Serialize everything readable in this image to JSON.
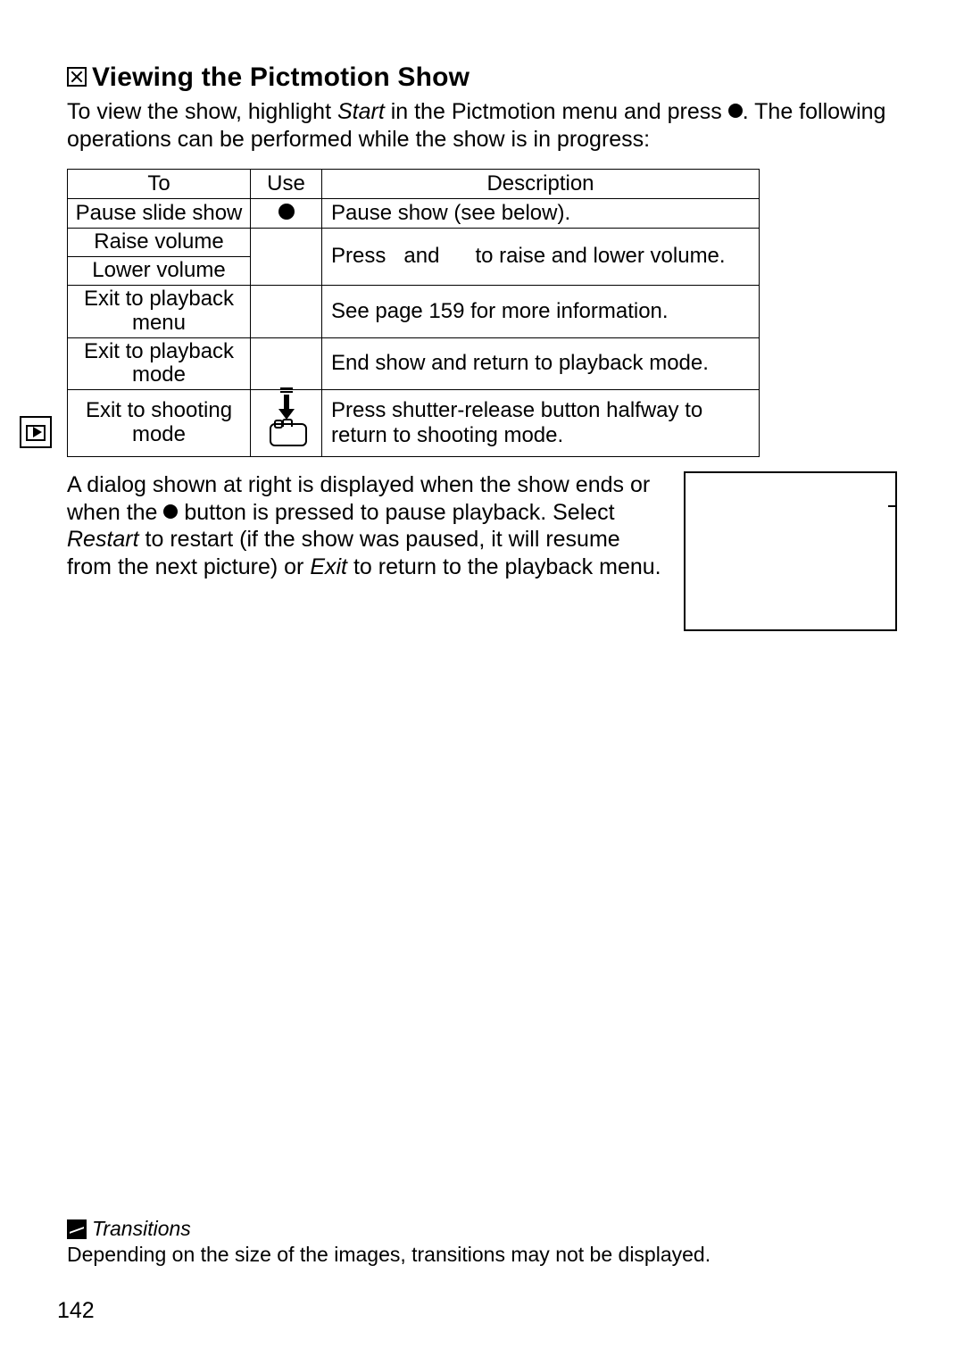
{
  "section": {
    "title": "Viewing the Pictmotion Show"
  },
  "intro": {
    "pre": "To view the show, highlight ",
    "start_word": "Start",
    "mid": " in the Pictmotion menu and press ",
    "post": ".  The following operations can be performed while the show is in progress:"
  },
  "table": {
    "headers": {
      "to": "To",
      "use": "Use",
      "desc": "Description"
    },
    "rows": {
      "pause": {
        "to": "Pause slide show",
        "desc": "Pause show (see below)."
      },
      "raise": {
        "to": "Raise volume"
      },
      "lower": {
        "to": "Lower volume"
      },
      "vol_desc": {
        "press": "Press",
        "and": "and",
        "tail": "to raise and lower volume."
      },
      "pbmenu": {
        "to1": "Exit to playback",
        "to2": "menu",
        "desc": "See page 159 for more information."
      },
      "pbmode": {
        "to1": "Exit to playback",
        "to2": "mode",
        "desc": "End show and return to playback mode."
      },
      "shoot": {
        "to1": "Exit to shooting",
        "to2": "mode",
        "desc": "Press shutter-release button halfway to return to shooting mode."
      }
    }
  },
  "dialog": {
    "p1": "A dialog shown at right is displayed when the show ends or when the ",
    "p2": " button is pressed to pause playback.  Select ",
    "restart": "Restart",
    "p3": " to restart (if the show was paused, it will resume from the next picture) or ",
    "exit": "Exit",
    "p4": " to return to the playback menu."
  },
  "footnote": {
    "title": "Transitions",
    "body": "Depending on the size of the images, transitions may not be displayed."
  },
  "page_number": "142"
}
